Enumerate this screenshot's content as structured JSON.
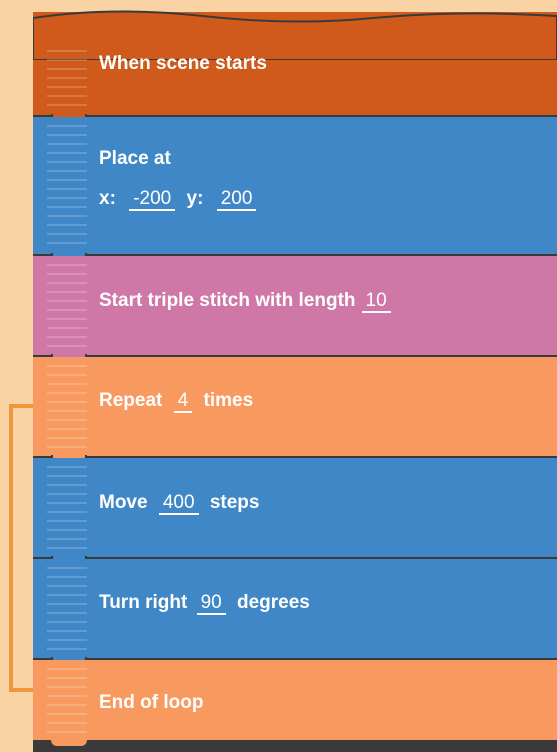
{
  "blocks": {
    "when_scene_starts": {
      "label": "When scene starts"
    },
    "place_at": {
      "label": "Place at",
      "x_label": "x:",
      "x_value": "-200",
      "y_label": "y:",
      "y_value": "200"
    },
    "triple_stitch": {
      "label": "Start triple stitch with length",
      "length_value": "10"
    },
    "repeat": {
      "prefix": "Repeat",
      "count_value": "4",
      "suffix": "times"
    },
    "move": {
      "prefix": "Move",
      "steps_value": "400",
      "suffix": "steps"
    },
    "turn_right": {
      "prefix": "Turn right",
      "degrees_value": "90",
      "suffix": "degrees"
    },
    "end_loop": {
      "label": "End of loop"
    }
  },
  "colors": {
    "background": "#f9d3a4",
    "event": "#cf5a1b",
    "motion": "#3f87c7",
    "stitch": "#cf78a7",
    "control": "#f89a60",
    "loop_bracket": "#f0973a"
  }
}
